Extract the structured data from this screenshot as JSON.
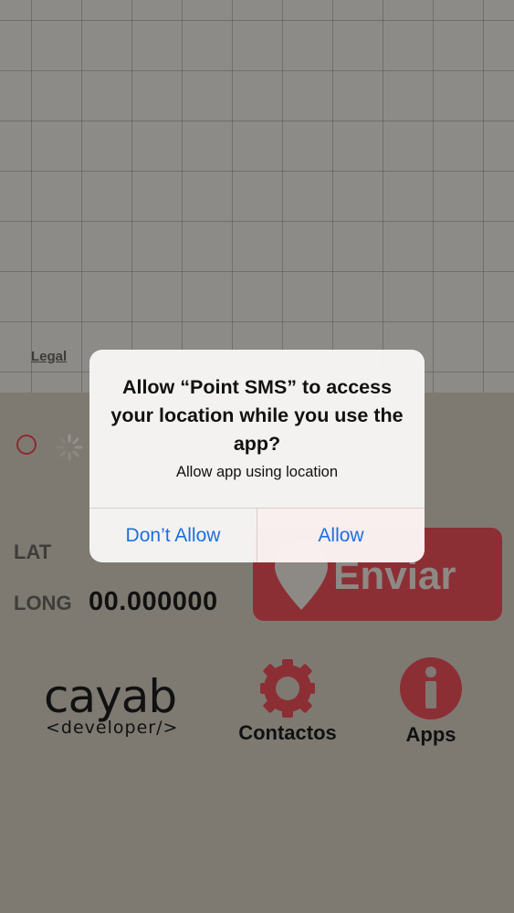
{
  "map": {
    "legal_label": "Legal"
  },
  "coords": {
    "lat_label": "LAT",
    "long_label": "LONG",
    "long_value": "00.000000"
  },
  "send": {
    "label": "Enviar",
    "icon": "location-pin-icon"
  },
  "brand": {
    "name": "cayab",
    "tagline": "<developer/>"
  },
  "toolbar": {
    "contacts_label": "Contactos",
    "contacts_icon": "gear-icon",
    "apps_label": "Apps",
    "apps_icon": "info-icon"
  },
  "alert": {
    "title": "Allow “Point SMS” to access your location while you use the app?",
    "message": "Allow app using location",
    "deny_label": "Don’t Allow",
    "allow_label": "Allow"
  },
  "colors": {
    "accent_red": "#8c2f34",
    "ios_blue": "#1d6fe0"
  }
}
